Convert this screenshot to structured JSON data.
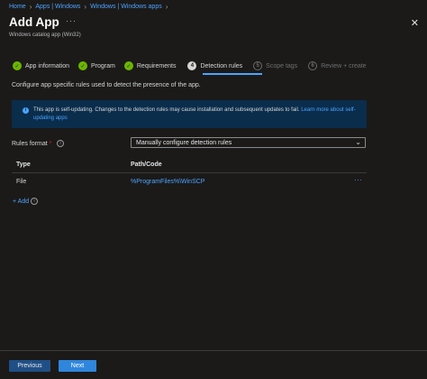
{
  "breadcrumb": {
    "items": [
      "Home",
      "Apps | Windows",
      "Windows | Windows apps"
    ]
  },
  "page": {
    "title": "Add App",
    "subtitle": "Windows catalog app (Win32)"
  },
  "steps": [
    {
      "label": "App information",
      "state": "done"
    },
    {
      "label": "Program",
      "state": "done"
    },
    {
      "label": "Requirements",
      "state": "done"
    },
    {
      "label": "Detection rules",
      "state": "current",
      "number": "4"
    },
    {
      "label": "Scope tags",
      "state": "todo",
      "number": "5"
    },
    {
      "label": "Review + create",
      "state": "todo",
      "number": "6"
    }
  ],
  "intro": "Configure app specific rules used to detect the presence of the app.",
  "info": {
    "text": "This app is self-updating. Changes to the detection rules may cause installation and subsequent updates to fail.",
    "link_text": "Learn more about self-updating apps"
  },
  "rules_format": {
    "label": "Rules format",
    "required_marker": "*",
    "value": "Manually configure detection rules"
  },
  "table": {
    "headers": [
      "Type",
      "Path/Code"
    ],
    "rows": [
      {
        "type": "File",
        "path": "%ProgramFiles%\\WinSCP"
      }
    ]
  },
  "add_label": "+ Add",
  "footer": {
    "previous": "Previous",
    "next": "Next"
  },
  "colors": {
    "accent": "#4da3ff",
    "done": "#6bb700",
    "info_bg": "#0a2d4c",
    "primary_button": "#2f86dc"
  },
  "icons": {
    "more": "ellipsis-icon",
    "close": "close-icon",
    "info": "info-icon",
    "help": "help-circle-icon",
    "dropdown": "chevron-down-icon"
  }
}
